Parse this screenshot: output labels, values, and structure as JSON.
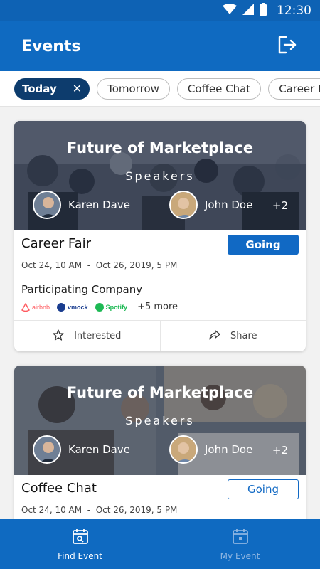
{
  "status_bar": {
    "time": "12:30"
  },
  "app_bar": {
    "title": "Events"
  },
  "filters": [
    {
      "label": "Today",
      "active": true
    },
    {
      "label": "Tomorrow",
      "active": false
    },
    {
      "label": "Coffee Chat",
      "active": false
    },
    {
      "label": "Career Fair",
      "active": false
    }
  ],
  "events": [
    {
      "banner_title": "Future of Marketplace",
      "banner_subtitle": "Speakers",
      "speakers": [
        "Karen Dave",
        "John Doe"
      ],
      "extra_speakers": "+2",
      "title": "Career Fair",
      "rsvp_label": "Going",
      "date_start": "Oct 24, 10 AM",
      "date_sep": "-",
      "date_end": "Oct 26, 2019, 5 PM",
      "company_label": "Participating Company",
      "companies": [
        "airbnb",
        "vmock",
        "Spotify"
      ],
      "more_companies": "+5 more",
      "interested_label": "Interested",
      "share_label": "Share"
    },
    {
      "banner_title": "Future of Marketplace",
      "banner_subtitle": "Speakers",
      "speakers": [
        "Karen Dave",
        "John Doe"
      ],
      "extra_speakers": "+2",
      "title": "Coffee Chat",
      "rsvp_label": "Going",
      "date_start": "Oct 24, 10 AM",
      "date_sep": "-",
      "date_end": "Oct 26, 2019, 5 PM"
    }
  ],
  "bottom_nav": [
    {
      "label": "Find Event",
      "active": true
    },
    {
      "label": "My Event",
      "active": false
    }
  ],
  "colors": {
    "primary": "#0f6ac1",
    "chip_active": "#0d3c6d",
    "going_button": "#1169c4"
  }
}
